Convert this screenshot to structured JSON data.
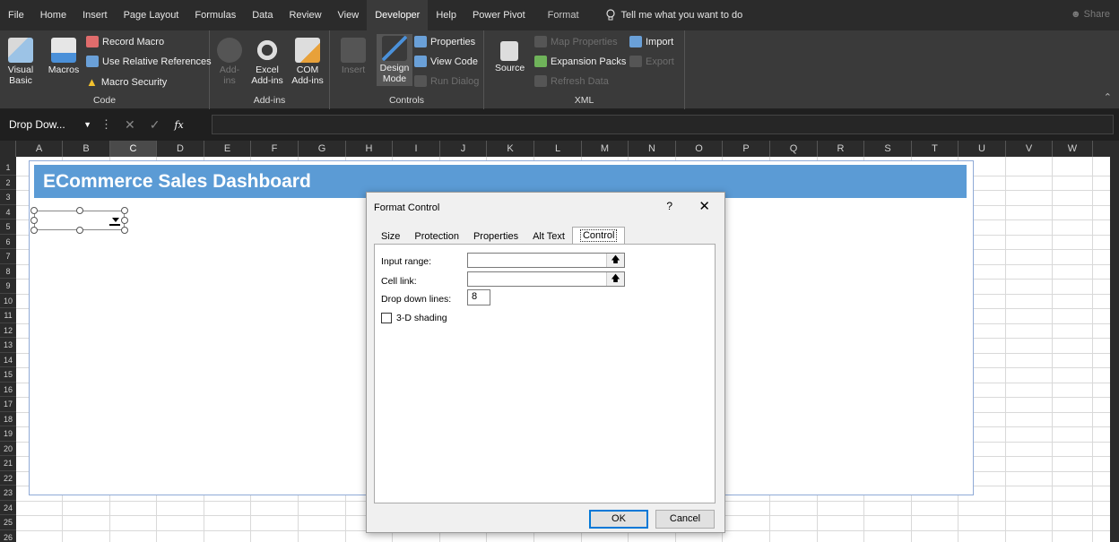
{
  "ribbon_tabs": [
    "File",
    "Home",
    "Insert",
    "Page Layout",
    "Formulas",
    "Data",
    "Review",
    "View",
    "Developer",
    "Help",
    "Power Pivot",
    "Format"
  ],
  "tell_me": "Tell me what you want to do",
  "share": "Share",
  "code_group": {
    "label": "Code",
    "visual_basic": "Visual\nBasic",
    "macros": "Macros",
    "record_macro": "Record Macro",
    "use_relative": "Use Relative References",
    "macro_security": "Macro Security"
  },
  "addins_group": {
    "label": "Add-ins",
    "addins": "Add-\nins",
    "excel_addins": "Excel\nAdd-ins",
    "com_addins": "COM\nAdd-ins"
  },
  "controls_group": {
    "label": "Controls",
    "insert": "Insert",
    "design_mode": "Design\nMode",
    "properties": "Properties",
    "view_code": "View Code",
    "run_dialog": "Run Dialog"
  },
  "xml_group": {
    "label": "XML",
    "source": "Source",
    "map_properties": "Map Properties",
    "expansion_packs": "Expansion Packs",
    "refresh_data": "Refresh Data",
    "import": "Import",
    "export": "Export"
  },
  "name_box": "Drop Dow...",
  "columns": [
    "A",
    "B",
    "C",
    "D",
    "E",
    "F",
    "G",
    "H",
    "I",
    "J",
    "K",
    "L",
    "M",
    "N",
    "O",
    "P",
    "Q",
    "R",
    "S",
    "T",
    "U",
    "V",
    "W"
  ],
  "rows": [
    "1",
    "2",
    "3",
    "4",
    "5",
    "6",
    "7",
    "8",
    "9",
    "10",
    "11",
    "12",
    "13",
    "14",
    "15",
    "16",
    "17",
    "18",
    "19",
    "20",
    "21",
    "22",
    "23",
    "24",
    "25",
    "26"
  ],
  "sheet": {
    "banner_title": "ECommerce Sales Dashboard"
  },
  "dialog": {
    "title": "Format Control",
    "help": "?",
    "tabs": [
      "Size",
      "Protection",
      "Properties",
      "Alt Text",
      "Control"
    ],
    "input_range_label": "Input range:",
    "cell_link_label": "Cell link:",
    "drop_down_lines_label": "Drop down lines:",
    "drop_down_lines_value": "8",
    "shading_label": "3-D shading",
    "ok": "OK",
    "cancel": "Cancel"
  },
  "colors": {
    "banner": "#5b9bd5",
    "ribbon": "#3a3a3a",
    "tabs_bg": "#2b2b2b"
  }
}
